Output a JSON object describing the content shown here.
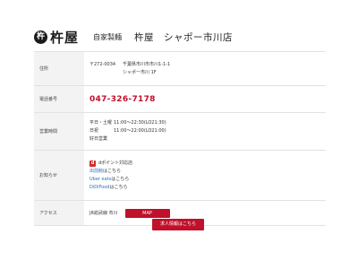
{
  "header": {
    "logo_mark": "杵",
    "logo_text": "杵屋",
    "subtitle": "自家製麺",
    "shop_name": "杵屋　シャポー市川店"
  },
  "rows": {
    "address": {
      "label": "住所",
      "zip": "〒272-0034",
      "line1": "千葉県市川市市川1-1-1",
      "line2": "シャポー市川 1F"
    },
    "phone": {
      "label": "電話番号",
      "value": "047-326-7178"
    },
    "hours": {
      "label": "営業時間",
      "weekday_day": "平日・土曜",
      "weekday_time": "11:00～22:30(LO21:30)",
      "holiday_day": "日祝",
      "holiday_time": "11:00～22:00(LO21:00)",
      "closed": "好日営業"
    },
    "notice": {
      "label": "お知らせ",
      "dpoint": "dポイント対応店",
      "demae_link": "出前館",
      "demae_suffix": "はこちら",
      "ubereats_link": "Uber eats",
      "ubereats_suffix": "はこちら",
      "didi_link": "DiDiFood",
      "didi_suffix": "はこちら"
    },
    "access": {
      "label": "アクセス",
      "value": "JR総武線 市川",
      "map_button": "MAP"
    }
  },
  "recruit_button": "求人情報はこちら",
  "colors": {
    "accent": "#c0102a",
    "link": "#2b6fb8",
    "label_bg": "#f3f3f3"
  }
}
